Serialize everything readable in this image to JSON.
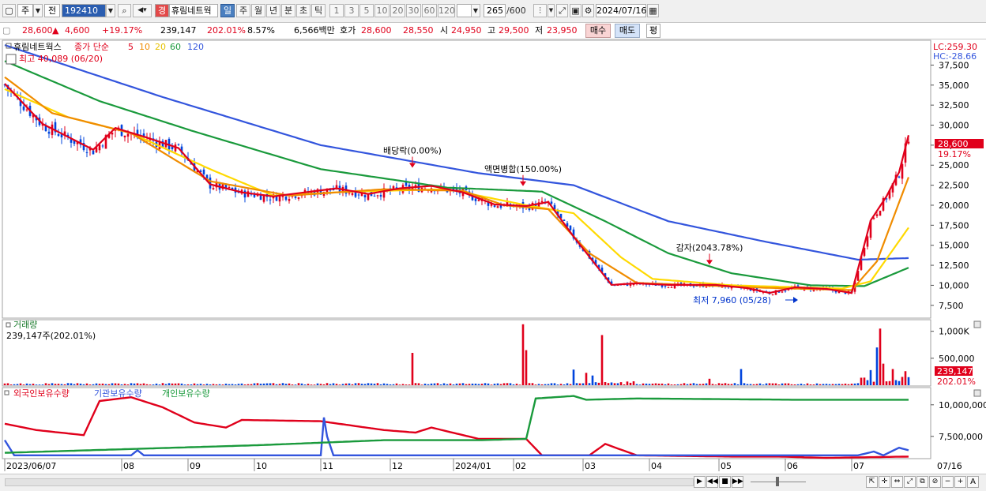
{
  "toolbar": {
    "code": "192410",
    "stock_name": "휴림네트웍",
    "mode_jeon": "전",
    "mode_ju": "주",
    "period_buttons": [
      "일",
      "주",
      "월",
      "년",
      "분",
      "초",
      "틱"
    ],
    "selected_period": "일",
    "interval_buttons": [
      "1",
      "3",
      "5",
      "10",
      "20",
      "30",
      "60",
      "120"
    ],
    "count": "265",
    "count_max": "/600",
    "date": "2024/07/16",
    "gyeong": "경"
  },
  "quote": {
    "price": "28,600",
    "change": "4,600",
    "change_pct": "+19.17%",
    "volume": "239,147",
    "volume_ratio": "202.01%",
    "turnover_ratio": "8.57%",
    "amount": "6,566백만",
    "hoga_label": "호가",
    "ask": "28,600",
    "bid": "28,550",
    "open_label": "시",
    "open": "24,950",
    "high_label": "고",
    "high": "29,500",
    "low_label": "저",
    "low": "23,950",
    "buy_label": "매수",
    "sell_label": "매도",
    "flat_label": "평"
  },
  "price_panel": {
    "name_tag": "휴림네트웍스",
    "ma_label": "종가 단순",
    "ma_periods": [
      "5",
      "10",
      "20",
      "60",
      "120"
    ],
    "ma_colors": [
      "#e0001b",
      "#f08c00",
      "#ffd900",
      "#1a9a3c",
      "#3355dd"
    ],
    "max_label": "최고 40,089 (06/20)",
    "min_label": "최저 7,960 (05/28)",
    "lc": "LC:259.30",
    "hc": "HC:-28.66",
    "current_price_tag": "28,600",
    "current_pct_tag": "19.17%",
    "annotations": [
      "배당락(0.00%)",
      "액면병합(150.00%)",
      "감자(2043.78%)"
    ]
  },
  "volume_panel": {
    "title": "거래량",
    "value": "239,147주(202.01%)",
    "current_tag": "239,147",
    "current_pct": "202.01%"
  },
  "holding_panel": {
    "series_labels": [
      "외국인보유수량",
      "기관보유수량",
      "개인보유수량"
    ],
    "series_colors": [
      "#e0001b",
      "#3355dd",
      "#1a9a3c"
    ]
  },
  "x_axis_labels": [
    "2023/06/07",
    "08",
    "09",
    "10",
    "11",
    "12",
    "2024/01",
    "02",
    "03",
    "04",
    "05",
    "06",
    "07",
    "07/16"
  ],
  "chart_data": [
    {
      "type": "candlestick",
      "y_ticks": [
        "37,500",
        "35,000",
        "32,500",
        "30,000",
        "27,500",
        "25,000",
        "22,500",
        "20,000",
        "17,500",
        "15,000",
        "12,500",
        "10,000",
        "7,500"
      ],
      "ylim": [
        6000,
        40500
      ],
      "close_anchors": [
        [
          0,
          35000
        ],
        [
          12,
          30000
        ],
        [
          22,
          28000
        ],
        [
          28,
          26800
        ],
        [
          35,
          29500
        ],
        [
          45,
          28300
        ],
        [
          55,
          27000
        ],
        [
          65,
          22500
        ],
        [
          75,
          21500
        ],
        [
          85,
          21000
        ],
        [
          95,
          21500
        ],
        [
          105,
          22000
        ],
        [
          115,
          21300
        ],
        [
          125,
          22000
        ],
        [
          135,
          22300
        ],
        [
          145,
          21500
        ],
        [
          155,
          20000
        ],
        [
          165,
          19800
        ],
        [
          172,
          20300
        ],
        [
          180,
          16000
        ],
        [
          192,
          10000
        ],
        [
          200,
          10200
        ],
        [
          210,
          10000
        ],
        [
          225,
          10000
        ],
        [
          235,
          9600
        ],
        [
          242,
          9000
        ],
        [
          250,
          9700
        ],
        [
          260,
          9500
        ],
        [
          268,
          9000
        ],
        [
          274,
          18000
        ],
        [
          279,
          21000
        ],
        [
          283,
          24000
        ],
        [
          286,
          28600
        ]
      ],
      "ma120_anchors": [
        [
          0,
          40000
        ],
        [
          50,
          33500
        ],
        [
          100,
          27500
        ],
        [
          150,
          24000
        ],
        [
          180,
          22500
        ],
        [
          210,
          18000
        ],
        [
          240,
          15500
        ],
        [
          270,
          13200
        ],
        [
          286,
          13400
        ]
      ],
      "ma60_anchors": [
        [
          0,
          38000
        ],
        [
          30,
          33000
        ],
        [
          60,
          29200
        ],
        [
          100,
          24500
        ],
        [
          140,
          22200
        ],
        [
          170,
          21700
        ],
        [
          190,
          18000
        ],
        [
          210,
          14000
        ],
        [
          230,
          11500
        ],
        [
          255,
          10000
        ],
        [
          272,
          9900
        ],
        [
          286,
          12200
        ]
      ],
      "ma20_anchors": [
        [
          0,
          34500
        ],
        [
          20,
          31000
        ],
        [
          40,
          29000
        ],
        [
          65,
          24500
        ],
        [
          85,
          21200
        ],
        [
          110,
          21700
        ],
        [
          140,
          22000
        ],
        [
          165,
          20000
        ],
        [
          180,
          19000
        ],
        [
          195,
          13500
        ],
        [
          205,
          10800
        ],
        [
          230,
          10000
        ],
        [
          265,
          9600
        ],
        [
          274,
          10500
        ],
        [
          286,
          17200
        ]
      ],
      "ma10_anchors": [
        [
          0,
          36000
        ],
        [
          15,
          31500
        ],
        [
          40,
          29000
        ],
        [
          65,
          23000
        ],
        [
          90,
          21200
        ],
        [
          120,
          22000
        ],
        [
          145,
          21800
        ],
        [
          158,
          20000
        ],
        [
          172,
          19500
        ],
        [
          185,
          14000
        ],
        [
          200,
          10300
        ],
        [
          240,
          9700
        ],
        [
          268,
          9400
        ],
        [
          276,
          13000
        ],
        [
          286,
          23500
        ]
      ],
      "events": [
        {
          "i": 129,
          "label": "배당락(0.00%)"
        },
        {
          "i": 164,
          "label": "액면병합(150.00%)"
        },
        {
          "i": 223,
          "label": "감자(2043.78%)"
        }
      ]
    },
    {
      "type": "bar",
      "y_ticks": [
        "1,000K",
        "500,000"
      ],
      "ylim": [
        0,
        1200
      ],
      "spikes": [
        [
          129,
          600
        ],
        [
          164,
          1130
        ],
        [
          165,
          650
        ],
        [
          180,
          290
        ],
        [
          184,
          230
        ],
        [
          186,
          180
        ],
        [
          189,
          930
        ],
        [
          223,
          120
        ],
        [
          233,
          300
        ],
        [
          274,
          280
        ],
        [
          276,
          700
        ],
        [
          277,
          1050
        ],
        [
          278,
          400
        ],
        [
          281,
          300
        ],
        [
          285,
          260
        ]
      ]
    },
    {
      "type": "line",
      "y_ticks": [
        "10,000,000",
        "7,500,000"
      ],
      "series": [
        {
          "name": "외국인보유수량",
          "anchors": [
            [
              0,
              8500
            ],
            [
              10,
              8000
            ],
            [
              25,
              7600
            ],
            [
              30,
              10300
            ],
            [
              40,
              10600
            ],
            [
              50,
              9800
            ],
            [
              60,
              8600
            ],
            [
              70,
              8200
            ],
            [
              75,
              8800
            ],
            [
              100,
              8700
            ],
            [
              120,
              8000
            ],
            [
              130,
              7800
            ],
            [
              135,
              8200
            ],
            [
              150,
              7300
            ],
            [
              165,
              7300
            ],
            [
              170,
              6000
            ],
            [
              185,
              6000
            ],
            [
              190,
              6900
            ],
            [
              200,
              6000
            ],
            [
              230,
              5900
            ],
            [
              245,
              5900
            ],
            [
              260,
              5800
            ],
            [
              286,
              5900
            ]
          ]
        },
        {
          "name": "기관보유수량",
          "anchors": [
            [
              0,
              7200
            ],
            [
              3,
              6000
            ],
            [
              40,
              6000
            ],
            [
              42,
              6400
            ],
            [
              44,
              6000
            ],
            [
              100,
              6000
            ],
            [
              101,
              9000
            ],
            [
              102,
              7500
            ],
            [
              104,
              6000
            ],
            [
              270,
              6000
            ],
            [
              275,
              6300
            ],
            [
              278,
              6000
            ],
            [
              283,
              6600
            ],
            [
              286,
              6400
            ]
          ]
        },
        {
          "name": "개인보유수량",
          "anchors": [
            [
              0,
              6200
            ],
            [
              40,
              6500
            ],
            [
              80,
              6800
            ],
            [
              120,
              7200
            ],
            [
              150,
              7200
            ],
            [
              165,
              7300
            ],
            [
              168,
              10500
            ],
            [
              180,
              10700
            ],
            [
              184,
              10400
            ],
            [
              200,
              10500
            ],
            [
              250,
              10400
            ],
            [
              286,
              10400
            ]
          ]
        }
      ],
      "ylim": [
        5800,
        11300
      ]
    }
  ]
}
